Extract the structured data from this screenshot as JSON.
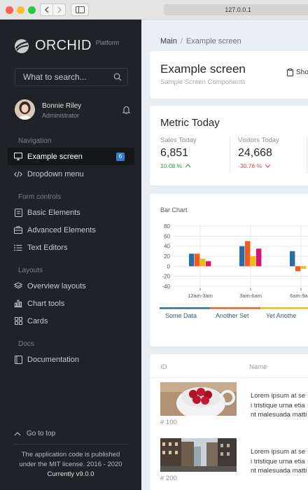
{
  "browser": {
    "url": "127.0.0.1"
  },
  "sidebar": {
    "brand": {
      "name": "ORCHID",
      "sub": "Platform"
    },
    "search": {
      "placeholder": "What to search..."
    },
    "user": {
      "name": "Bonnie Riley",
      "role": "Administrator"
    },
    "sections": [
      {
        "title": "Navigation",
        "items": [
          {
            "label": "Example screen",
            "icon": "monitor-icon",
            "active": true,
            "badge": "6"
          },
          {
            "label": "Dropdown menu",
            "icon": "code-icon"
          }
        ]
      },
      {
        "title": "Form controls",
        "items": [
          {
            "label": "Basic Elements",
            "icon": "note-icon"
          },
          {
            "label": "Advanced Elements",
            "icon": "briefcase-icon"
          },
          {
            "label": "Text Editors",
            "icon": "list-icon"
          }
        ]
      },
      {
        "title": "Layouts",
        "items": [
          {
            "label": "Overview layouts",
            "icon": "layers-icon"
          },
          {
            "label": "Chart tools",
            "icon": "bar-chart-icon"
          },
          {
            "label": "Cards",
            "icon": "grid-icon"
          }
        ]
      },
      {
        "title": "Docs",
        "items": [
          {
            "label": "Documentation",
            "icon": "book-icon"
          }
        ]
      }
    ],
    "go_top": "Go to top",
    "footer": {
      "line1": "The application code is published",
      "line2": "under the MIT license. 2016 - 2020",
      "line3": "Currently v9.0.0"
    }
  },
  "main": {
    "breadcrumb": {
      "first": "Main",
      "sep": "/",
      "current": "Example screen"
    },
    "page": {
      "title": "Example screen",
      "subtitle": "Sample Screen Components",
      "show_label": "Sho"
    },
    "metrics": {
      "title": "Metric Today",
      "items": [
        {
          "label": "Sales Today",
          "value": "6,851",
          "change": "10.08 %",
          "direction": "up"
        },
        {
          "label": "Visitors Today",
          "value": "24,668",
          "change": "-30.76 %",
          "direction": "down"
        }
      ]
    },
    "chart_title": "Bar Chart",
    "table": {
      "headers": [
        "ID",
        "Name"
      ],
      "rows": [
        {
          "id": "# 100",
          "text": [
            "Lorem ipsum at se",
            "i tristique urna etia",
            "nt malesuada matti"
          ],
          "image": "raspberries-photo"
        },
        {
          "id": "# 200",
          "text": [
            "Lorem ipsum at se",
            "i tristique urna etia",
            "nt malesuada matti"
          ],
          "image": "city-street-photo"
        }
      ]
    }
  },
  "colors": {
    "sidebar_bg": "#1f2226",
    "main_bg": "#e9eef3",
    "badge": "#2e7ed6",
    "positive": "#2e9e4f",
    "negative": "#e24d4d",
    "series": [
      "#2b6ca3",
      "#f25d1c",
      "#f6b910",
      "#d6136e"
    ]
  },
  "chart_data": {
    "type": "bar",
    "title": "Bar Chart",
    "categories": [
      "12am-3am",
      "3am-6am",
      "6am-9am"
    ],
    "series": [
      {
        "name": "Some Data",
        "values": [
          25,
          40,
          30
        ]
      },
      {
        "name": "Another Set",
        "values": [
          25,
          50,
          -10
        ]
      },
      {
        "name": "Yet Anothe",
        "values": [
          15,
          20,
          -5
        ]
      },
      {
        "name": "",
        "values": [
          10,
          35,
          0
        ]
      }
    ],
    "ylim": [
      -40,
      80
    ],
    "yticks": [
      80,
      60,
      40,
      20,
      0,
      -20,
      -40
    ],
    "grid": true,
    "legend": "bottom"
  }
}
